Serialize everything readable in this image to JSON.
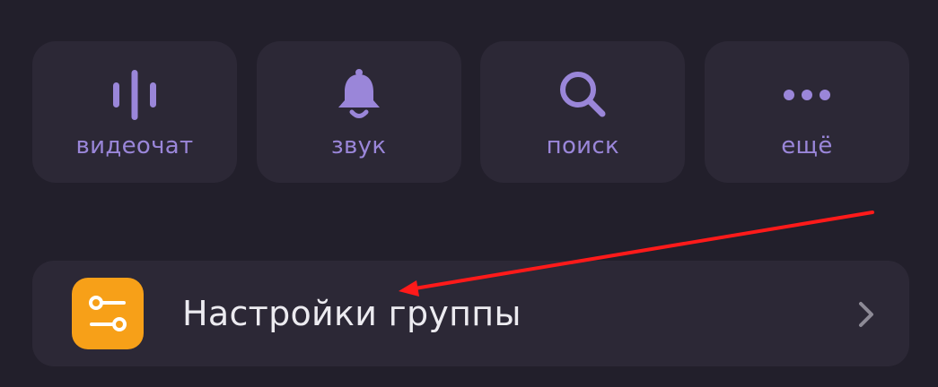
{
  "colors": {
    "background": "#221f2b",
    "card": "#2c2836",
    "accent_purple": "#9a86d9",
    "settings_icon_bg": "#f7a018",
    "annotation_arrow": "#ff1a1a"
  },
  "actions": [
    {
      "label": "видеочат",
      "icon": "audio-wave-icon"
    },
    {
      "label": "звук",
      "icon": "bell-icon"
    },
    {
      "label": "поиск",
      "icon": "search-icon"
    },
    {
      "label": "ещё",
      "icon": "more-dots-icon"
    }
  ],
  "settings_row": {
    "label": "Настройки группы",
    "icon": "sliders-icon"
  }
}
